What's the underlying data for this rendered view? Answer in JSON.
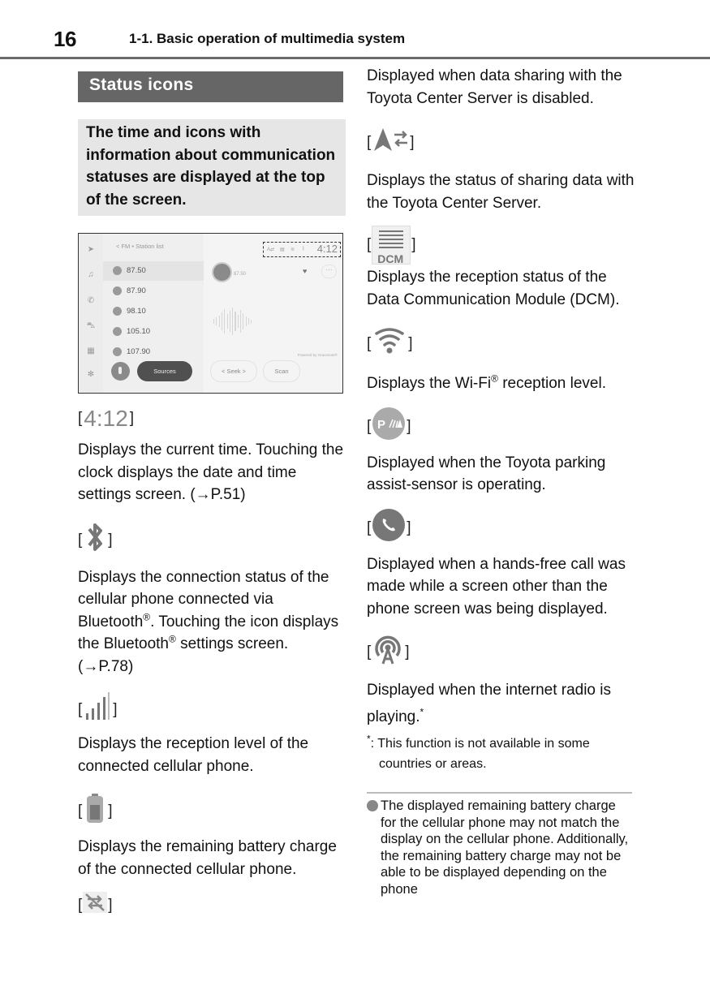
{
  "header": {
    "page_number": "16",
    "section_path": "1-1. Basic operation of multimedia system"
  },
  "section": {
    "title": "Status icons",
    "intro": "The time and icons with information about communication statuses are displayed at the top of the screen."
  },
  "screen_mockup": {
    "breadcrumb": "<  FM  •  Station list",
    "stations": [
      "87.50",
      "87.90",
      "98.10",
      "105.10",
      "107.90"
    ],
    "active_station": "87.50",
    "now_playing_freq": "87.50",
    "status_clock": "4:12",
    "powered_by": "Powered by Gracenote®",
    "sources_label": "Sources",
    "seek_label": "<  Seek  >",
    "scan_label": "Scan",
    "rail_icons": [
      "navigation-icon",
      "music-icon",
      "phone-icon",
      "car-icon",
      "apps-icon",
      "settings-icon"
    ]
  },
  "entries_left": [
    {
      "icon": "clock",
      "icon_text": "4:12",
      "text": "Displays the current time. Touching the clock displays the date and time settings screen. (→P.51)"
    },
    {
      "icon": "bluetooth-icon",
      "text_parts": [
        "Displays the connection status of the cellular phone connected via Bluetooth",
        "®",
        ". Touching the icon displays the Bluetooth",
        "®",
        " settings screen. (→P.78)"
      ]
    },
    {
      "icon": "cellular-signal-icon",
      "text": "Displays the reception level of the connected cellular phone."
    },
    {
      "icon": "battery-icon",
      "text": "Displays the remaining battery charge of the connected cellular phone."
    },
    {
      "icon": "data-sharing-disabled-icon"
    }
  ],
  "entries_right": [
    {
      "icon": "data-sharing-disabled-icon",
      "text": "Displayed when data sharing with the Toyota Center Server is disabled."
    },
    {
      "icon": "data-sharing-status-icon",
      "text": "Displays the status of sharing data with the Toyota Center Server."
    },
    {
      "icon": "dcm-icon",
      "icon_text": "DCM",
      "text": "Displays the reception status of the Data Communication Module (DCM)."
    },
    {
      "icon": "wifi-icon",
      "text_parts": [
        "Displays the Wi-Fi",
        "®",
        " reception level."
      ]
    },
    {
      "icon": "parking-sensor-icon",
      "icon_text": "P",
      "text": "Displayed when the Toyota parking assist-sensor is operating."
    },
    {
      "icon": "hands-free-call-icon",
      "text": "Displayed when a hands-free call was made while a screen other than the phone screen was being displayed."
    },
    {
      "icon": "internet-radio-icon",
      "text": "Displayed when the internet radio is playing.",
      "mark": "*"
    }
  ],
  "footnote": {
    "mark": "*",
    "text": ": This function is not available in some countries or areas."
  },
  "note": "The displayed remaining battery charge for the cellular phone may not match the display on the cellular phone. Additionally, the remaining battery charge may not be able to be displayed depending on the phone",
  "brackets": {
    "open": "[",
    "close": "]"
  }
}
